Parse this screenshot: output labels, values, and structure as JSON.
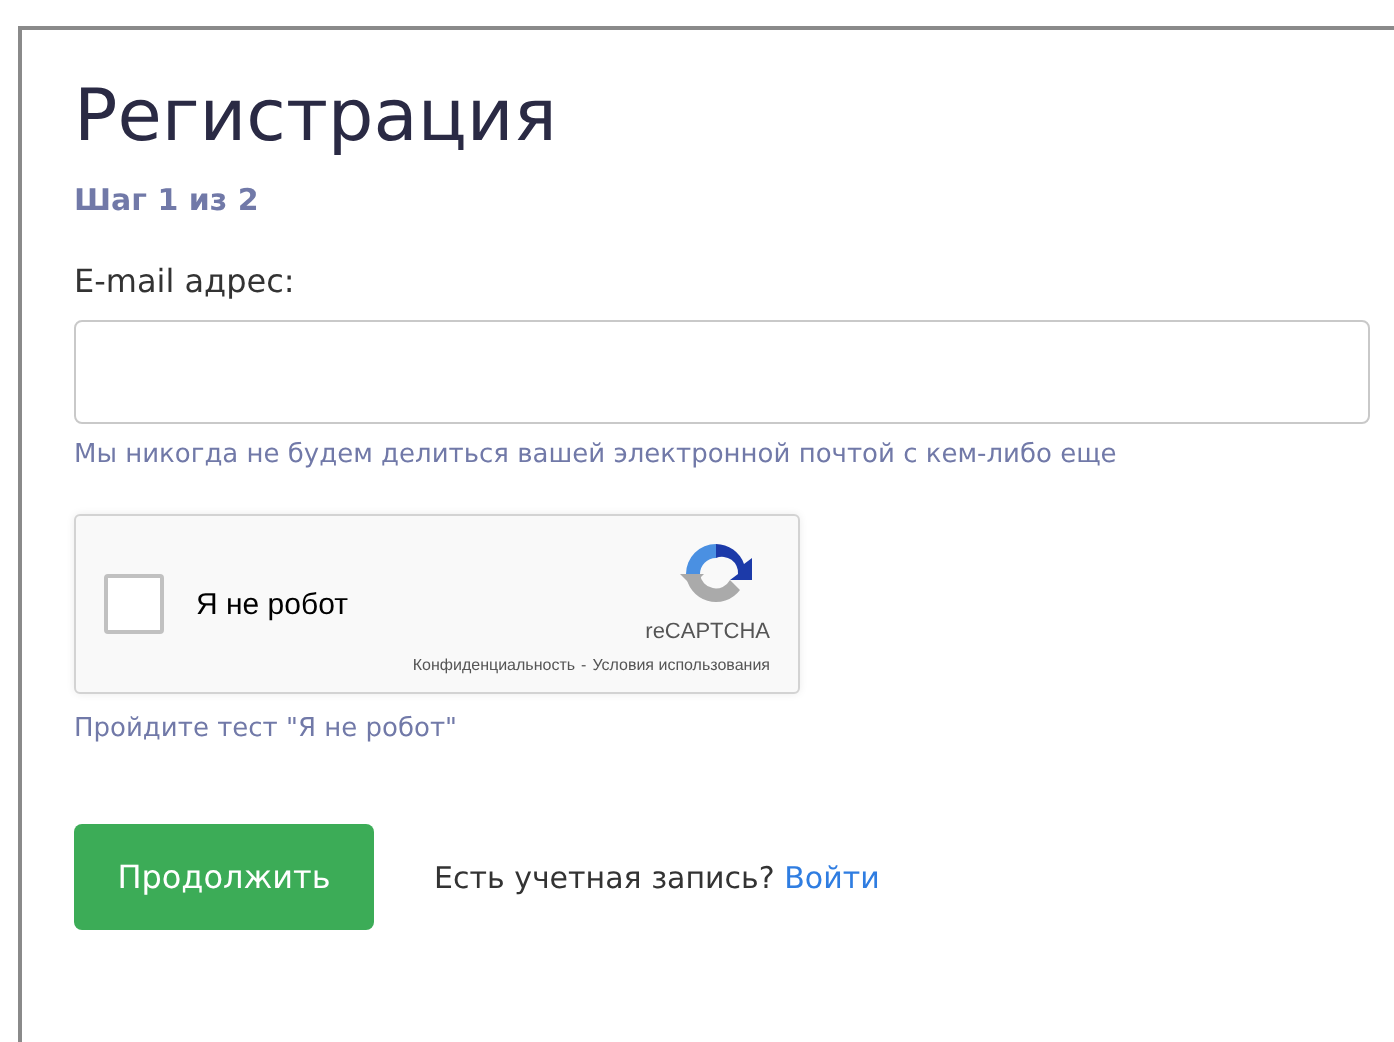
{
  "title": "Регистрация",
  "step": "Шаг 1 из 2",
  "email_field": {
    "label": "E-mail адрес:",
    "help": "Мы никогда не будем делиться вашей электронной почтой с кем-либо еще"
  },
  "captcha": {
    "checked": false,
    "label": "Я не робот",
    "brand": "reCAPTCHA",
    "privacy_link": "Конфиденциальность",
    "separator": "-",
    "terms_link": "Условия использования"
  },
  "captcha_error": "Пройдите тест \"Я не робот\"",
  "submit_button": "Продолжить",
  "login_prompt": {
    "text": "Есть учетная запись?",
    "link": "Войти"
  }
}
